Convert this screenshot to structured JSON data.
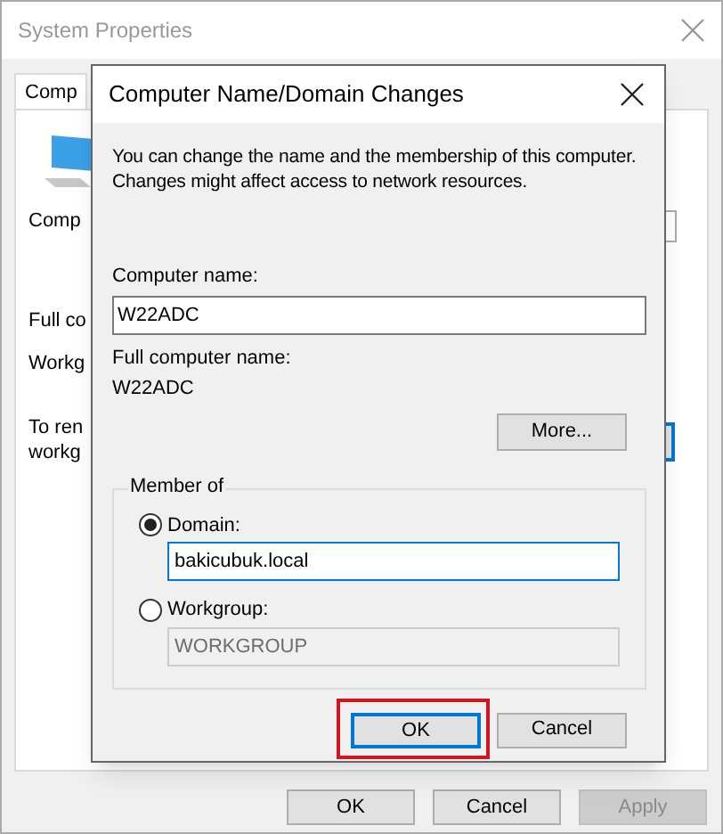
{
  "window": {
    "title": "System Properties"
  },
  "background": {
    "tab": {
      "label": "Comp",
      "selected": true
    },
    "texts": [
      "Comp",
      "Full co",
      "Workg",
      "To ren",
      "workg"
    ],
    "buttons": [
      {
        "label": "OK",
        "disabled": false
      },
      {
        "label": "Cancel",
        "disabled": false
      },
      {
        "label": "Apply",
        "disabled": true
      }
    ]
  },
  "dialog": {
    "title": "Computer Name/Domain Changes",
    "description": "You can change the name and the membership of this computer. Changes might affect access to network resources.",
    "computer_name": {
      "label": "Computer name:",
      "value": "W22ADC"
    },
    "full_name": {
      "label": "Full computer name:",
      "value": "W22ADC"
    },
    "more_button": "More...",
    "member_of": {
      "label": "Member of",
      "options": [
        {
          "label": "Domain:",
          "selected": true,
          "value": "bakicubuk.local"
        },
        {
          "label": "Workgroup:",
          "selected": false,
          "value": "WORKGROUP"
        }
      ]
    },
    "buttons": [
      {
        "label": "OK",
        "default": true
      },
      {
        "label": "Cancel",
        "default": false
      }
    ]
  }
}
